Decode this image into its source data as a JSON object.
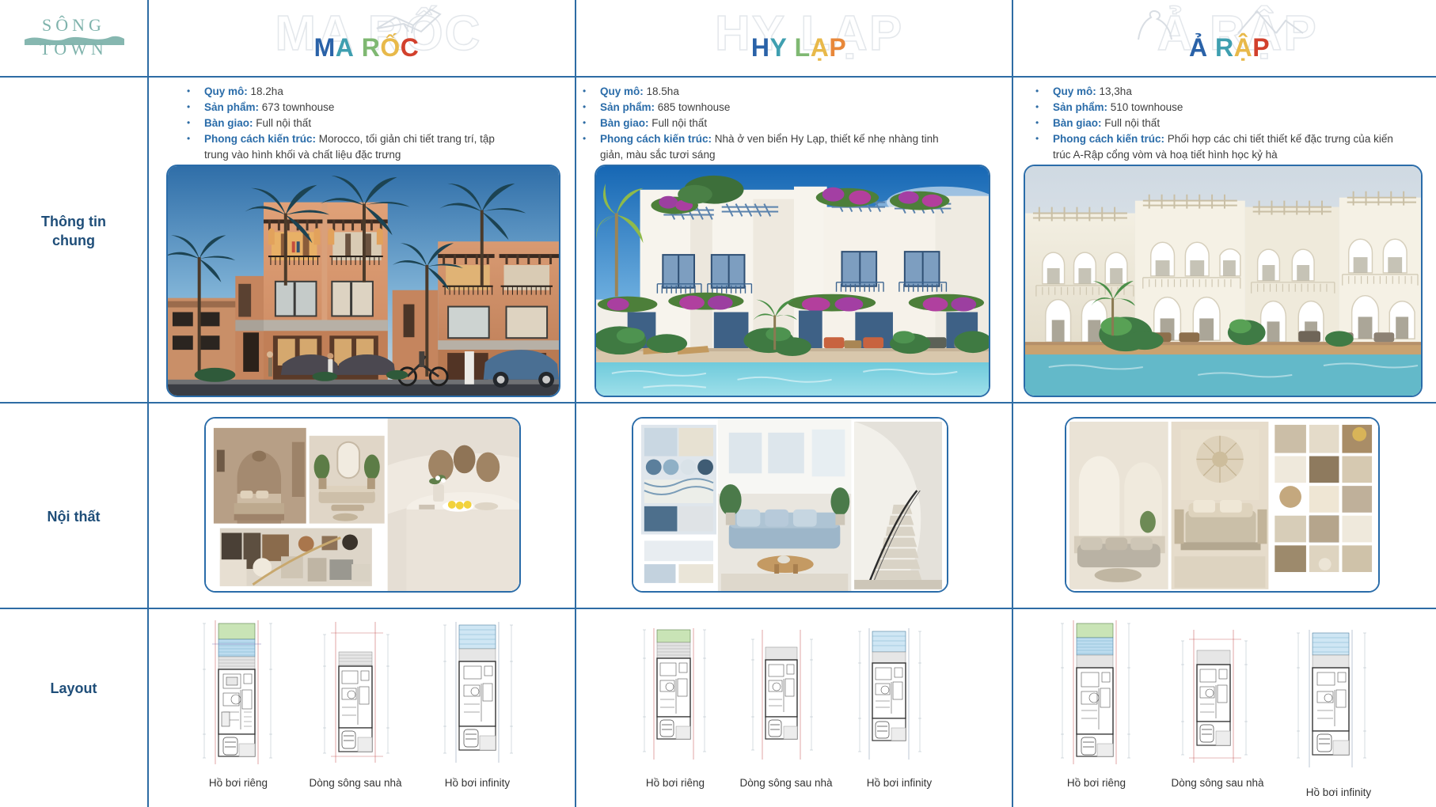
{
  "brand": {
    "line1": "SÔNG",
    "line2": "TOWN"
  },
  "rows": [
    {
      "key": "thong-tin-chung",
      "label": "Thông tin\nchung"
    },
    {
      "key": "noi-that",
      "label": "Nội thất"
    },
    {
      "key": "layout",
      "label": "Layout"
    }
  ],
  "columns": [
    {
      "key": "ma-roc",
      "title_letters": [
        {
          "ch": "M",
          "color": "#2a62a8"
        },
        {
          "ch": "A",
          "color": "#3f9fb0"
        },
        {
          "ch": " ",
          "color": "#000000"
        },
        {
          "ch": "R",
          "color": "#7fb872"
        },
        {
          "ch": "Ố",
          "color": "#e8b94a"
        },
        {
          "ch": "C",
          "color": "#d2402c"
        }
      ],
      "title_plain": "MA RỐC",
      "ghost": "MA RỐC",
      "ghost_icon": "bird-icon",
      "info": [
        {
          "label": "Quy mô:",
          "value": "18.2ha"
        },
        {
          "label": "Sản phẩm:",
          "value": "673 townhouse"
        },
        {
          "label": "Bàn giao:",
          "value": "Full nội thất"
        },
        {
          "label": "Phong cách kiến trúc:",
          "value": "Morocco, tối giản chi tiết trang trí, tập trung vào hình khối và chất liệu đặc trưng"
        }
      ],
      "render_alt": "Phối cảnh townhouse phong cách Morocco",
      "interior_alt": "Bảng mood board nội thất tông đất Morocco",
      "plans": [
        {
          "caption": "Hồ bơi riêng"
        },
        {
          "caption": "Dòng sông sau nhà"
        },
        {
          "caption": "Hồ bơi infinity"
        }
      ]
    },
    {
      "key": "hy-lap",
      "title_letters": [
        {
          "ch": "H",
          "color": "#2a62a8"
        },
        {
          "ch": "Y",
          "color": "#3f9fb0"
        },
        {
          "ch": " ",
          "color": "#000000"
        },
        {
          "ch": "L",
          "color": "#7fb872"
        },
        {
          "ch": "Ạ",
          "color": "#e8b94a"
        },
        {
          "ch": "P",
          "color": "#e8883a"
        }
      ],
      "title_plain": "HY LẠP",
      "ghost": "HY LẠP",
      "ghost_icon": "windmill-icon",
      "info": [
        {
          "label": "Quy mô:",
          "value": "18.5ha"
        },
        {
          "label": "Sản phẩm:",
          "value": "685 townhouse"
        },
        {
          "label": "Bàn giao:",
          "value": "Full nội thất"
        },
        {
          "label": "Phong cách kiến trúc:",
          "value": "Nhà ở ven biển Hy Lạp, thiết kế nhẹ nhàng tinh giản, màu sắc tươi sáng"
        }
      ],
      "render_alt": "Phối cảnh townhouse phong cách Hy Lạp bên hồ bơi",
      "interior_alt": "Bảng mood board nội thất tông xanh Hy Lạp",
      "plans": [
        {
          "caption": "Hồ bơi riêng"
        },
        {
          "caption": "Dòng sông sau nhà"
        },
        {
          "caption": "Hồ bơi infinity"
        }
      ]
    },
    {
      "key": "a-rap",
      "title_letters": [
        {
          "ch": "Ả",
          "color": "#2a62a8"
        },
        {
          "ch": " ",
          "color": "#000000"
        },
        {
          "ch": "R",
          "color": "#3f9fb0"
        },
        {
          "ch": "Ậ",
          "color": "#e8b94a"
        },
        {
          "ch": "P",
          "color": "#d2402c"
        }
      ],
      "title_plain": "Ả RẬP",
      "ghost": "Ả RẬP",
      "ghost_icon": "camel-icon",
      "info": [
        {
          "label": "Quy mô:",
          "value": "13,3ha"
        },
        {
          "label": "Sản phẩm:",
          "value": "510 townhouse"
        },
        {
          "label": "Bàn giao:",
          "value": "Full nội thất"
        },
        {
          "label": "Phong cách kiến trúc:",
          "value": "Phối hợp các chi tiết thiết kế đặc trưng của kiến trúc A-Rập cổng vòm và hoạ tiết hình học kỷ hà"
        }
      ],
      "render_alt": "Phối cảnh townhouse phong cách Ả Rập",
      "interior_alt": "Bảng mood board nội thất tông kem Ả Rập",
      "plans": [
        {
          "caption": "Hồ bơi riêng"
        },
        {
          "caption": "Dòng sông sau nhà"
        },
        {
          "caption": "Hồ bơi infinity"
        }
      ]
    }
  ],
  "colors": {
    "grid_line": "#2e6ca4",
    "frame_border": "#2a6ca9",
    "row_label": "#1f4e79",
    "bullet_label": "#2a6ca9",
    "body_text": "#3f3f3f",
    "brand": "#7fb3ac"
  }
}
